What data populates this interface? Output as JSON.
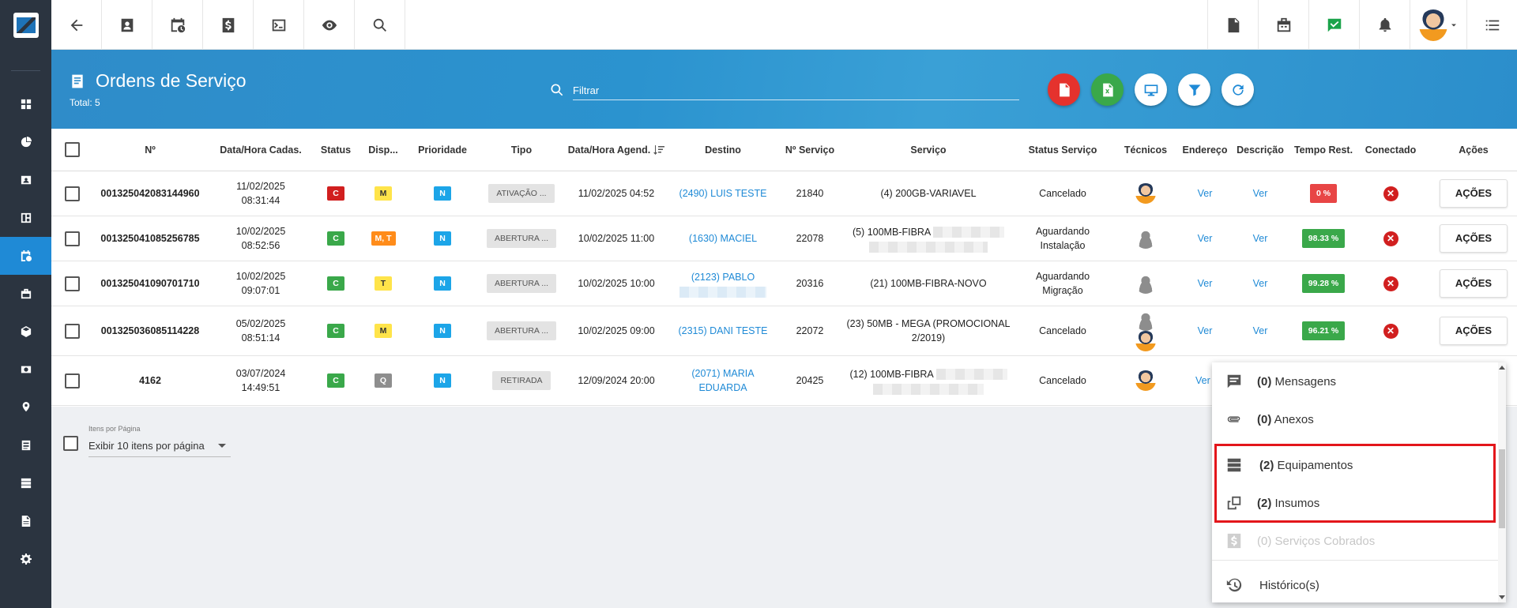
{
  "header": {
    "title": "Ordens de Serviço",
    "total": "Total: 5",
    "filter_placeholder": "Filtrar"
  },
  "columns": [
    "Nº",
    "Data/Hora Cadas.",
    "Status",
    "Disp...",
    "Prioridade",
    "Tipo",
    "Data/Hora Agend.",
    "Destino",
    "Nº Serviço",
    "Serviço",
    "Status Serviço",
    "Técnicos",
    "Endereço",
    "Descrição",
    "Tempo Rest.",
    "Conectado",
    "Ações"
  ],
  "rows": [
    {
      "num": "001325042083144960",
      "date": "11/02/2025",
      "time": "08:31:44",
      "status": "C",
      "disp": "M",
      "prioridade": "N",
      "tipo": "ATIVAÇÃO ...",
      "agend": "11/02/2025 04:52",
      "destino1": "(2490) LUIS TESTE",
      "destino2": "",
      "nservico": "21840",
      "servico1": "(4) 200GB-VARIAVEL",
      "servico2": "",
      "status_servico1": "Cancelado",
      "status_servico2": "",
      "endereco": "Ver",
      "descricao": "Ver",
      "tempo": "0 %",
      "acoes": "AÇÕES"
    },
    {
      "num": "001325041085256785",
      "date": "10/02/2025",
      "time": "08:52:56",
      "status": "C",
      "disp": "M, T",
      "prioridade": "N",
      "tipo": "ABERTURA ...",
      "agend": "10/02/2025 11:00",
      "destino1": "(1630) MACIEL",
      "destino2": "",
      "nservico": "22078",
      "servico1": "(5) 100MB-FIBRA",
      "servico2": "",
      "status_servico1": "Aguardando",
      "status_servico2": "Instalação",
      "endereco": "Ver",
      "descricao": "Ver",
      "tempo": "98.33 %",
      "acoes": "AÇÕES"
    },
    {
      "num": "001325041090701710",
      "date": "10/02/2025",
      "time": "09:07:01",
      "status": "C",
      "disp": "T",
      "prioridade": "N",
      "tipo": "ABERTURA ...",
      "agend": "10/02/2025 10:00",
      "destino1": "(2123) PABLO",
      "destino2": "",
      "nservico": "20316",
      "servico1": "(21) 100MB-FIBRA-NOVO",
      "servico2": "",
      "status_servico1": "Aguardando",
      "status_servico2": "Migração",
      "endereco": "Ver",
      "descricao": "Ver",
      "tempo": "99.28 %",
      "acoes": "AÇÕES"
    },
    {
      "num": "001325036085114228",
      "date": "05/02/2025",
      "time": "08:51:14",
      "status": "C",
      "disp": "M",
      "prioridade": "N",
      "tipo": "ABERTURA ...",
      "agend": "10/02/2025 09:00",
      "destino1": "(2315) DANI TESTE",
      "destino2": "",
      "nservico": "22072",
      "servico1": "(23) 50MB - MEGA (PROMOCIONAL",
      "servico2": "2/2019)",
      "status_servico1": "Cancelado",
      "status_servico2": "",
      "endereco": "Ver",
      "descricao": "Ver",
      "tempo": "96.21 %",
      "acoes": "AÇÕES"
    },
    {
      "num": "4162",
      "date": "03/07/2024",
      "time": "14:49:51",
      "status": "C",
      "disp": "Q",
      "prioridade": "N",
      "tipo": "RETIRADA",
      "agend": "12/09/2024 20:00",
      "destino1": "(2071) MARIA",
      "destino2": "EDUARDA",
      "nservico": "20425",
      "servico1": "(12) 100MB-FIBRA",
      "servico2": "",
      "status_servico1": "Cancelado",
      "status_servico2": "",
      "endereco": "Ver",
      "descricao": "",
      "tempo": "",
      "acoes": ""
    }
  ],
  "pagination": {
    "label": "Itens por Página",
    "value": "Exibir 10 itens por página"
  },
  "menu": {
    "items": [
      {
        "count": "(0)",
        "label": " Mensagens"
      },
      {
        "count": "(0)",
        "label": " Anexos"
      },
      {
        "count": "(2)",
        "label": " Equipamentos"
      },
      {
        "count": "(2)",
        "label": " Insumos"
      },
      {
        "count": "(0)",
        "label": " Serviços Cobrados"
      },
      {
        "count": "",
        "label": "Histórico(s)"
      }
    ]
  },
  "colors": {
    "accent": "#1f8ad6",
    "sidebar": "#2b3440",
    "highlight": "#e3161b"
  }
}
